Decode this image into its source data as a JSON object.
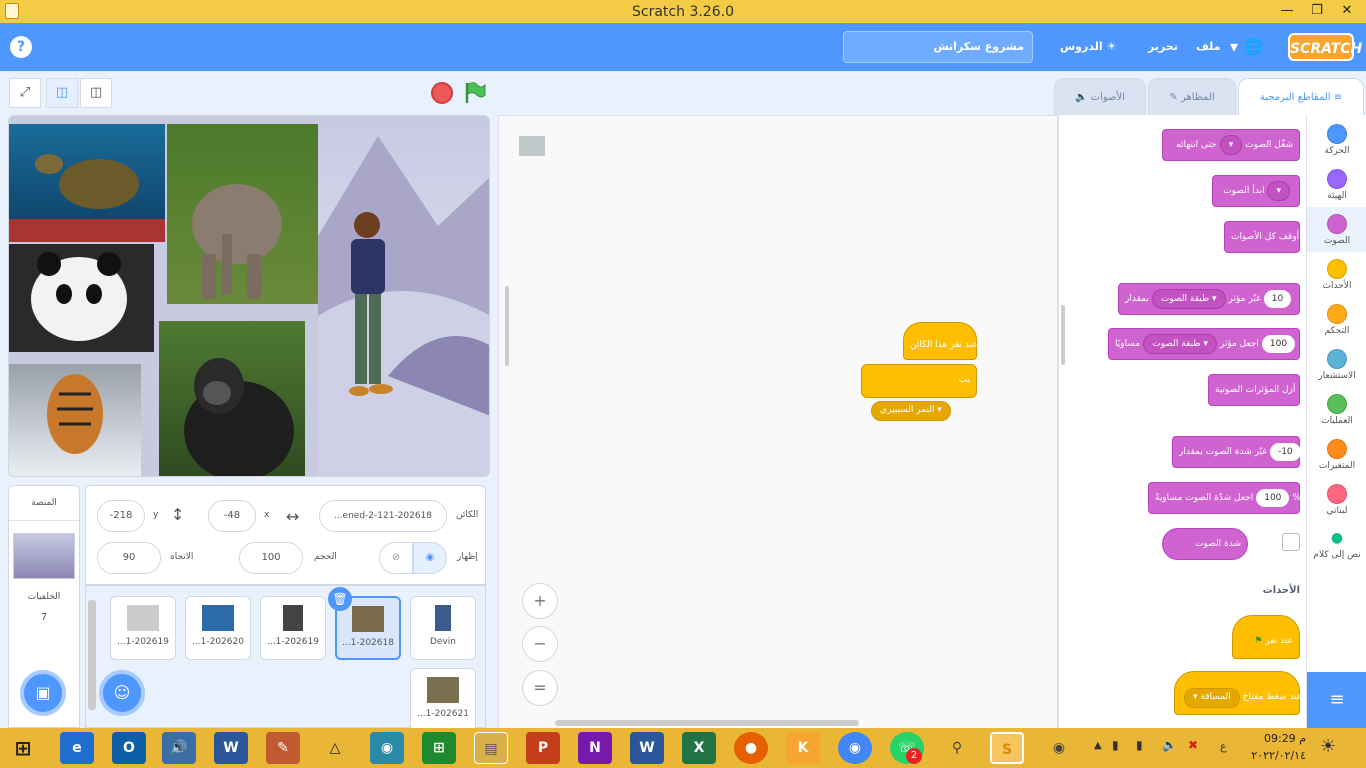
{
  "window": {
    "title": "Scratch 3.26.0"
  },
  "menubar": {
    "project_name": "مشروع سكراتش",
    "tutorials": "الدروس",
    "edit": "تحرير",
    "file": "ملف",
    "logo": "SCRATCH",
    "help": "?"
  },
  "tabs": {
    "code": "المقاطع البرمجية",
    "costumes": "المظاهر",
    "sounds": "الأصوات"
  },
  "categories": [
    {
      "label": "الحركة",
      "color": "#4c97ff"
    },
    {
      "label": "الهيئة",
      "color": "#9966ff"
    },
    {
      "label": "الصوت",
      "color": "#cf63cf"
    },
    {
      "label": "الأحداث",
      "color": "#ffbf00"
    },
    {
      "label": "التحكم",
      "color": "#ffab19"
    },
    {
      "label": "الاستشعار",
      "color": "#5cb1d6"
    },
    {
      "label": "العمليات",
      "color": "#59c059"
    },
    {
      "label": "المتغيرات",
      "color": "#ff8c1a"
    },
    {
      "label": "لبناتي",
      "color": "#ff6680"
    },
    {
      "label": "نص إلى كلام",
      "color": "#0fbd8c"
    }
  ],
  "palette": {
    "play_until_done": "شغّل الصوت",
    "until_done": "حتى انتهائه",
    "start_sound": "ابدأ الصوت",
    "stop_all_sounds": "أوقف كل الأصوات",
    "change_effect": "غيّر مؤثر",
    "effect_pitch": "طبقة الصوت",
    "by": "بمقدار",
    "change_effect_value": "10",
    "set_effect": "اجعل مؤثر",
    "equal": "مساويًا",
    "set_effect_value": "100",
    "clear_effects": "أزل المؤثرات الصوتية",
    "change_volume": "غيّر شدة الصوت بمقدار",
    "change_volume_value": "-10",
    "set_volume": "اجعل شدّة الصوت مساويةً",
    "set_volume_value": "100",
    "percent": "%",
    "volume": "شدة الصوت",
    "events_header": "الأحداث",
    "when_flag": "عند نقر",
    "when_key": "عند ضغط مفتاح",
    "key_space": "المسافة"
  },
  "script": {
    "hat": "عند نقر هذا الكائن",
    "broadcast": "بث",
    "message": "النمر السيبيري"
  },
  "sprite_info": {
    "sprite_label": "الكائن",
    "sprite_name": "...ened-2-121-202618",
    "x_label": "x",
    "x_value": "-48",
    "y_label": "y",
    "y_value": "-218",
    "show_label": "إظهار",
    "size_label": "الحجم",
    "size_value": "100",
    "direction_label": "الاتجاه",
    "direction_value": "90"
  },
  "sprites": [
    {
      "name": "Devin",
      "color": "#3b5b8f"
    },
    {
      "name": "...1-202618",
      "color": "#7a6a4a",
      "selected": true
    },
    {
      "name": "...1-202619",
      "color": "#444444"
    },
    {
      "name": "...1-202620",
      "color": "#2d6aa8"
    },
    {
      "name": "...1-202619",
      "color": "#cccccc"
    },
    {
      "name": "...1-202621",
      "color": "#7a7050"
    }
  ],
  "stage_pane": {
    "title": "المنصة",
    "backdrops_label": "الخلفيات",
    "backdrops_count": "7"
  },
  "taskbar": {
    "time": "09:29 م",
    "date": "٢٠٢٢/٠٢/١٤",
    "lang": "ع",
    "whatsapp_badge": "2"
  }
}
